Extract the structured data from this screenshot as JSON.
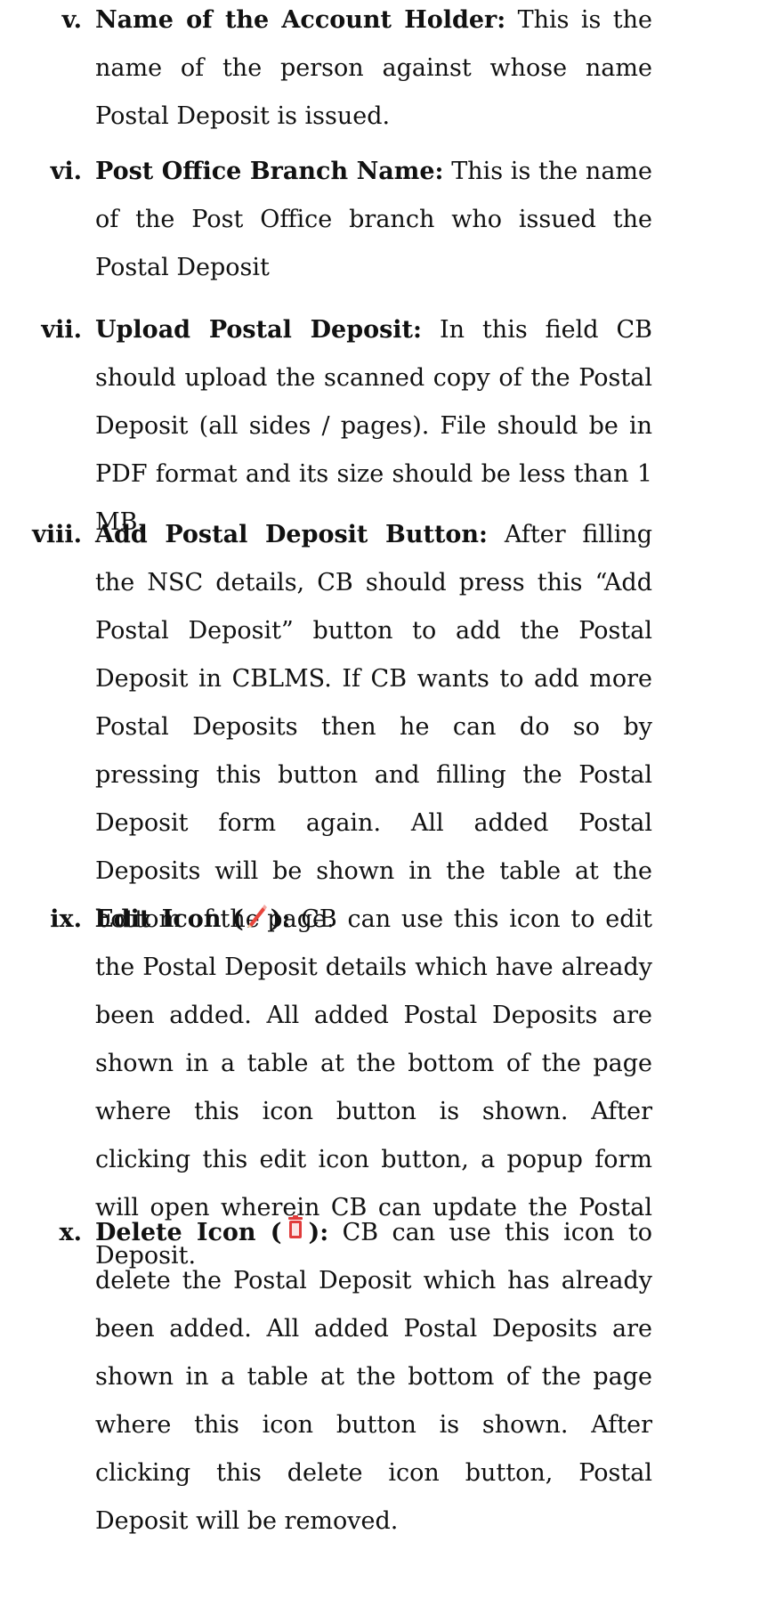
{
  "items": [
    {
      "numeral": "v.",
      "term": "Name of the Account Holder:",
      "text": " This is the name of the person against whose name Postal Deposit is issued."
    },
    {
      "numeral": "vi.",
      "term": "Post Office Branch Name:",
      "text": " This is the name of the Post Office branch who issued the Postal Deposit"
    },
    {
      "numeral": "vii.",
      "term": "Upload Postal Deposit:",
      "text": " In this field CB should upload the scanned copy of the Postal Deposit (all sides / pages). File should be in PDF format and its size should be less than 1 MB."
    },
    {
      "numeral": "viii.",
      "term": "Add Postal Deposit Button:",
      "text": " After filling the NSC details, CB should press this “Add Postal Deposit” button to add the Postal Deposit in CBLMS. If CB wants to add more Postal Deposits then he can do so by pressing this button and filling the Postal Deposit form again. All added Postal Deposits will be shown in the table at the bottom of the page."
    },
    {
      "numeral": "ix.",
      "term_prefix": "Edit Icon (",
      "icon": "pencil-icon",
      "term_suffix": "):",
      "text": " CB can use this icon to edit the Postal Deposit details which have already been added. All added Postal Deposits are shown in a table at the bottom of the page where this icon button  is shown. After clicking this edit icon button, a popup form will open wherein CB can update the Postal Deposit."
    },
    {
      "numeral": "x.",
      "term_prefix": "Delete Icon   (",
      "icon": "trash-icon",
      "term_suffix": "):",
      "text": " CB can use this icon to delete the Postal Deposit which has already been added. All added Postal Deposits are shown in a table at the bottom of the page where this icon button  is shown. After clicking this delete icon button, Postal Deposit will be removed."
    }
  ],
  "colors": {
    "text": "#111111",
    "pencil_body": "#e8453c",
    "pencil_tip": "#f6c9a0",
    "trash": "#e03b3b"
  }
}
